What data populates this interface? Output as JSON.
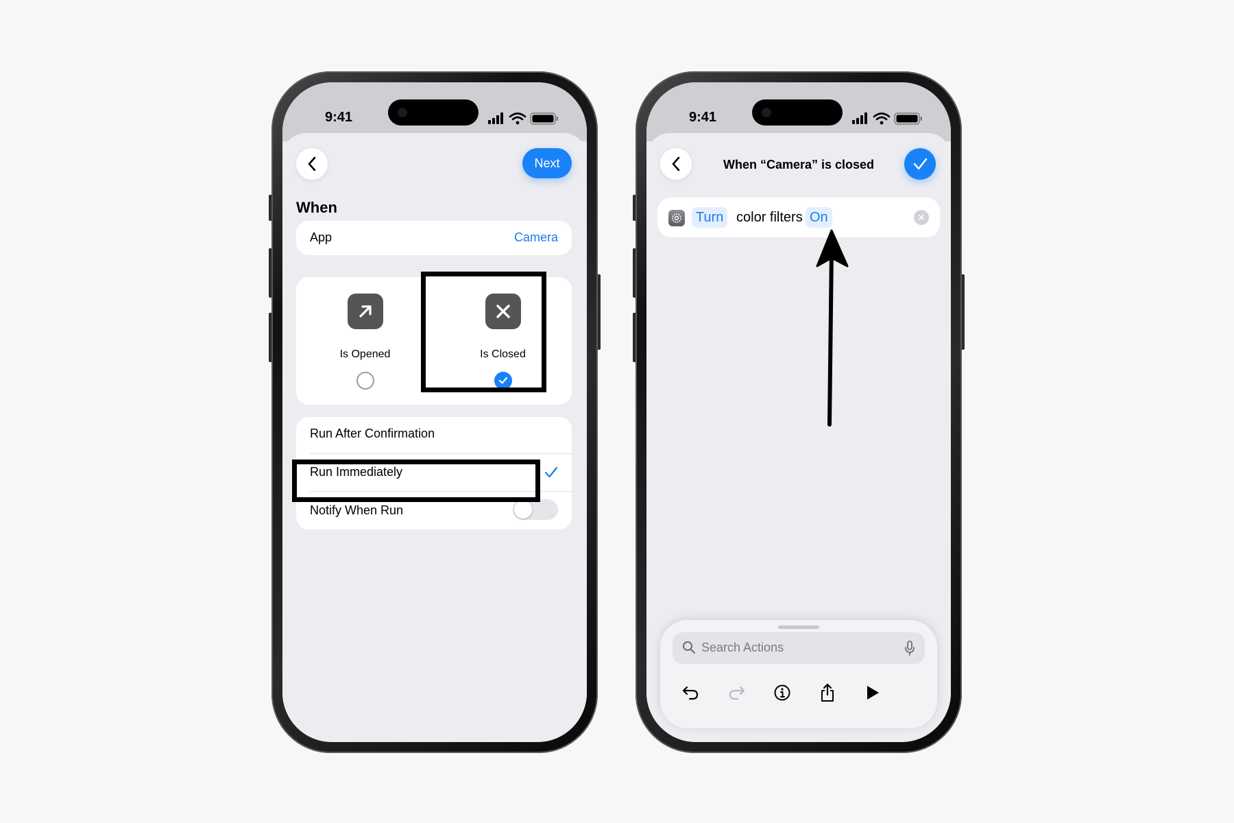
{
  "phone_left": {
    "status": {
      "time": "9:41"
    },
    "header": {
      "next_label": "Next"
    },
    "section_title": "When",
    "app_row": {
      "label": "App",
      "value": "Camera"
    },
    "choices": [
      {
        "label": "Is Opened",
        "icon": "arrow-up-right-icon",
        "selected": false
      },
      {
        "label": "Is Closed",
        "icon": "xmark-icon",
        "selected": true
      }
    ],
    "run_options": {
      "after_confirmation": "Run After Confirmation",
      "immediately": "Run Immediately",
      "immediately_selected": true,
      "notify": "Notify When Run",
      "notify_enabled": false
    }
  },
  "phone_right": {
    "status": {
      "time": "9:41"
    },
    "header": {
      "title": "When “Camera” is closed"
    },
    "action": {
      "verb": "Turn",
      "object": "color filters",
      "state": "On",
      "icon": "settings-gear-icon"
    },
    "search": {
      "placeholder": "Search Actions"
    },
    "toolbar": [
      "undo-icon",
      "redo-icon",
      "info-icon",
      "share-icon",
      "play-icon"
    ]
  },
  "colors": {
    "accent": "#1a82f7",
    "highlight": "#000000",
    "background": "#f7f7f7"
  }
}
